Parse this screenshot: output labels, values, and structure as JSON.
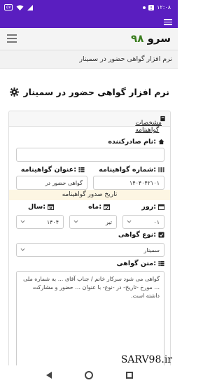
{
  "status_bar": {
    "time": "۱۲:۰۸",
    "battery": "۵۷"
  },
  "navbar": {
    "brand_text": "سرو",
    "brand_number": "۹۸"
  },
  "subtitle": "نرم افزار گواهی حضور در سمینار",
  "page_title": "نرم افزار گواهی حضور در سمینار",
  "card": {
    "header": "مشخصات گواهینامه",
    "issuer_label": "نام صادرکننده:",
    "issuer_value": "",
    "cert_number_label": "شماره گواهینامه:",
    "cert_number_value": "۱۴۰۴۰۴۲۱۰۱",
    "cert_title_label": "عنوان گواهینامه:",
    "cert_title_value": "گواهی حضور در",
    "issue_date_banner": "تاریخ صدور گواهینامه",
    "day_label": "روز:",
    "day_value": "۰۱",
    "month_label": "ماه:",
    "month_value": "تیر",
    "year_label": "سال:",
    "year_value": "۱۴۰۴",
    "type_label": "نوع گواهی:",
    "type_value": "سمینار",
    "text_label": "متن گواهی:",
    "text_value": "گواهی می شود سرکار خانم / جناب آقای ... به شماره ملی ... مورخ -تاریخ- در -نوع- با عنوان ... حضور و مشارکت داشته است."
  },
  "watermark": "SARV98.ir"
}
